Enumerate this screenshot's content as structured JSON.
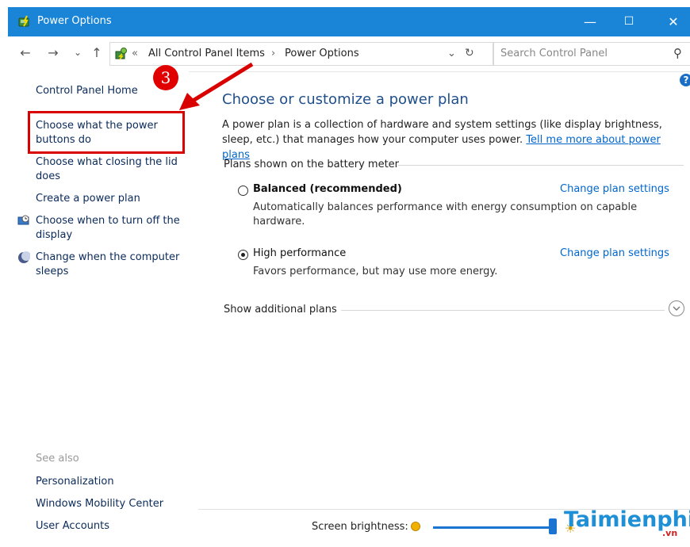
{
  "window": {
    "title": "Power Options",
    "controls": {
      "minimize": "—",
      "maximize": "☐",
      "close": "✕"
    }
  },
  "addressbar": {
    "back": "←",
    "forward": "→",
    "recent": "⌄",
    "up": "↑",
    "chevrons": "«",
    "breadcrumbs": [
      "All Control Panel Items",
      "Power Options"
    ],
    "separator": "›",
    "dropdown": "⌄",
    "refresh": "↻",
    "search_placeholder": "Search Control Panel",
    "search_icon": "⚲"
  },
  "sidebar": {
    "home": "Control Panel Home",
    "items": [
      "Choose what the power buttons do",
      "Choose what closing the lid does",
      "Create a power plan",
      "Choose when to turn off the display",
      "Change when the computer sleeps"
    ],
    "see_also_label": "See also",
    "see_also": [
      "Personalization",
      "Windows Mobility Center",
      "User Accounts"
    ]
  },
  "main": {
    "heading": "Choose or customize a power plan",
    "description": "A power plan is a collection of hardware and system settings (like display brightness, sleep, etc.) that manages how your computer uses power.",
    "learn_more": "Tell me more about power plans",
    "plans_label": "Plans shown on the battery meter",
    "plans": [
      {
        "name": "Balanced (recommended)",
        "description": "Automatically balances performance with energy consumption on capable hardware.",
        "selected": false,
        "link": "Change plan settings"
      },
      {
        "name": "High performance",
        "description": "Favors performance, but may use more energy.",
        "selected": true,
        "link": "Change plan settings"
      }
    ],
    "more_plans": "Show additional plans",
    "expand_icon": "chevron-down-icon",
    "help": "?"
  },
  "brightness": {
    "label": "Screen brightness:",
    "value_fraction": 1.0,
    "max_icon": "☀"
  },
  "annotation": {
    "step_number": "3",
    "color": "#d90000"
  },
  "watermark": {
    "text": "Taimienphi",
    "suffix": ".vn"
  }
}
